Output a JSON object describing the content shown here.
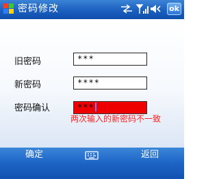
{
  "title_bar": {
    "app_title": "密码修改",
    "ok_label": "ok",
    "icons": [
      "windows-start-icon",
      "sync-icon",
      "signal-icon",
      "volume-icon"
    ]
  },
  "form": {
    "old_password": {
      "label": "旧密码",
      "value": "***"
    },
    "new_password": {
      "label": "新密码",
      "value": "****"
    },
    "confirm_password": {
      "label": "密码确认",
      "value": "***"
    },
    "error_message": "两次输入的新密码不一致"
  },
  "menu_bar": {
    "left_label": "确定",
    "right_label": "返回",
    "center_icon": "keyboard-icon"
  },
  "colors": {
    "title_bar": "#1b5fbf",
    "error_field": "#ee0000",
    "error_text": "#ff2020"
  }
}
